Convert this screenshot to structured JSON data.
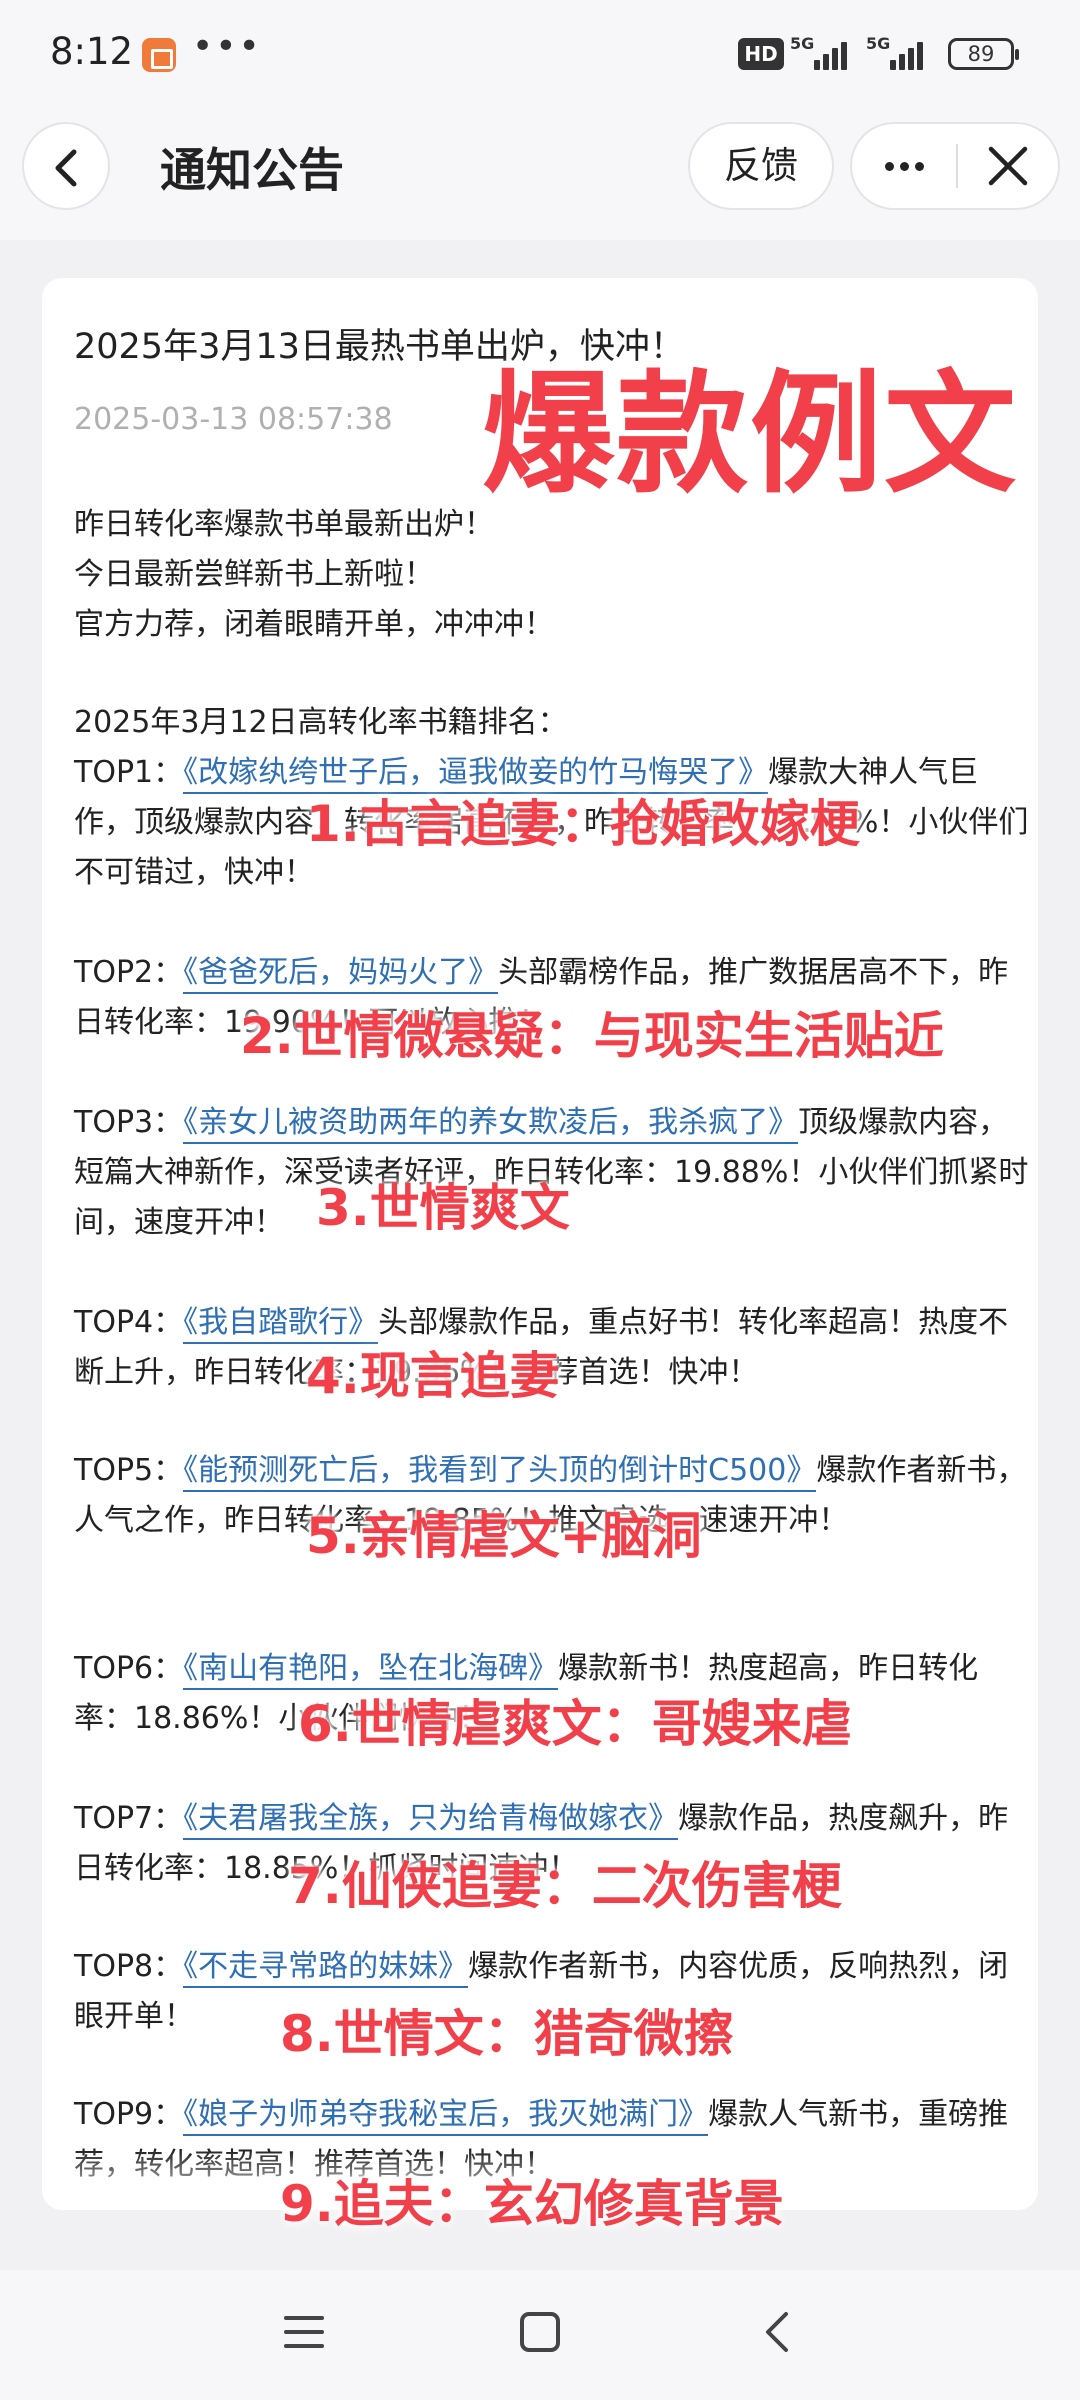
{
  "status_bar": {
    "time": "8:12",
    "dots": "•••",
    "hd": "HD",
    "network_1": "5G",
    "network_2": "5G",
    "battery": "89"
  },
  "header": {
    "title": "通知公告",
    "feedback_label": "反馈"
  },
  "article": {
    "title": "2025年3月13日最热书单出炉，快冲！",
    "date": "2025-03-13 08:57:38",
    "intro": [
      "昨日转化率爆款书单最新出炉！",
      "今日最新尝鲜新书上新啦！",
      "官方力荐，闭着眼睛开单，冲冲冲！"
    ],
    "ranking_heading": "2025年3月12日高转化率书籍排名：",
    "entries": [
      {
        "rank": "TOP1：",
        "book": "《改嫁纨绔世子后，逼我做妾的竹马悔哭了》",
        "desc": "爆款大神人气巨作，顶级爆款内容，转化率居高不下，昨日转化率：19.97%！小伙伴们不可错过，快冲！"
      },
      {
        "rank": "TOP2：",
        "book": "《爸爸死后，妈妈火了》",
        "desc": "头部霸榜作品，推广数据居高不下，昨日转化率：19.90%！可以放心推！"
      },
      {
        "rank": "TOP3：",
        "book": "《亲女儿被资助两年的养女欺凌后，我杀疯了》",
        "desc": "顶级爆款内容，短篇大神新作，深受读者好评，昨日转化率：19.88%！小伙伴们抓紧时间，速度开冲！"
      },
      {
        "rank": "TOP4：",
        "book": "《我自踏歌行》",
        "desc": "头部爆款作品，重点好书！转化率超高！热度不断上升，昨日转化率：19.86%！推荐首选！快冲！"
      },
      {
        "rank": "TOP5：",
        "book": "《能预测死亡后，我看到了头顶的倒计时C500》",
        "desc": "爆款作者新书，人气之作，昨日转化率：19.85%！推文良选，速速开冲！"
      },
      {
        "rank": "TOP6：",
        "book": "《南山有艳阳，坠在北海碑》",
        "desc": "爆款新书！热度超高，昨日转化率：18.86%！小伙伴们快冲！"
      },
      {
        "rank": "TOP7：",
        "book": "《夫君屠我全族，只为给青梅做嫁衣》",
        "desc": "爆款作品，热度飙升，昨日转化率：18.85%！抓紧时间速冲！"
      },
      {
        "rank": "TOP8：",
        "book": "《不走寻常路的妹妹》",
        "desc": "爆款作者新书，内容优质，反响热烈，闭眼开单！"
      },
      {
        "rank": "TOP9：",
        "book": "《娘子为师弟夺我秘宝后，我灭她满门》",
        "desc": "爆款人气新书，重磅推荐，转化率超高！推荐首选！快冲！"
      }
    ]
  },
  "overlays": {
    "headline": "爆款例文",
    "categories": [
      "1.古言追妻：抢婚改嫁梗",
      "2.世情微悬疑：与现实生活贴近",
      "3.世情爽文",
      "4.现言追妻",
      "5.亲情虐文+脑洞",
      "6.世情虐爽文：哥嫂来虐",
      "7.仙侠追妻：二次伤害梗",
      "8.世情文：猎奇微擦",
      "9.追夫：玄幻修真背景"
    ],
    "color": "#f2404b"
  },
  "colors": {
    "link": "#2f6fb6",
    "date": "#b0b0b0",
    "background": "#f1f1f3"
  }
}
